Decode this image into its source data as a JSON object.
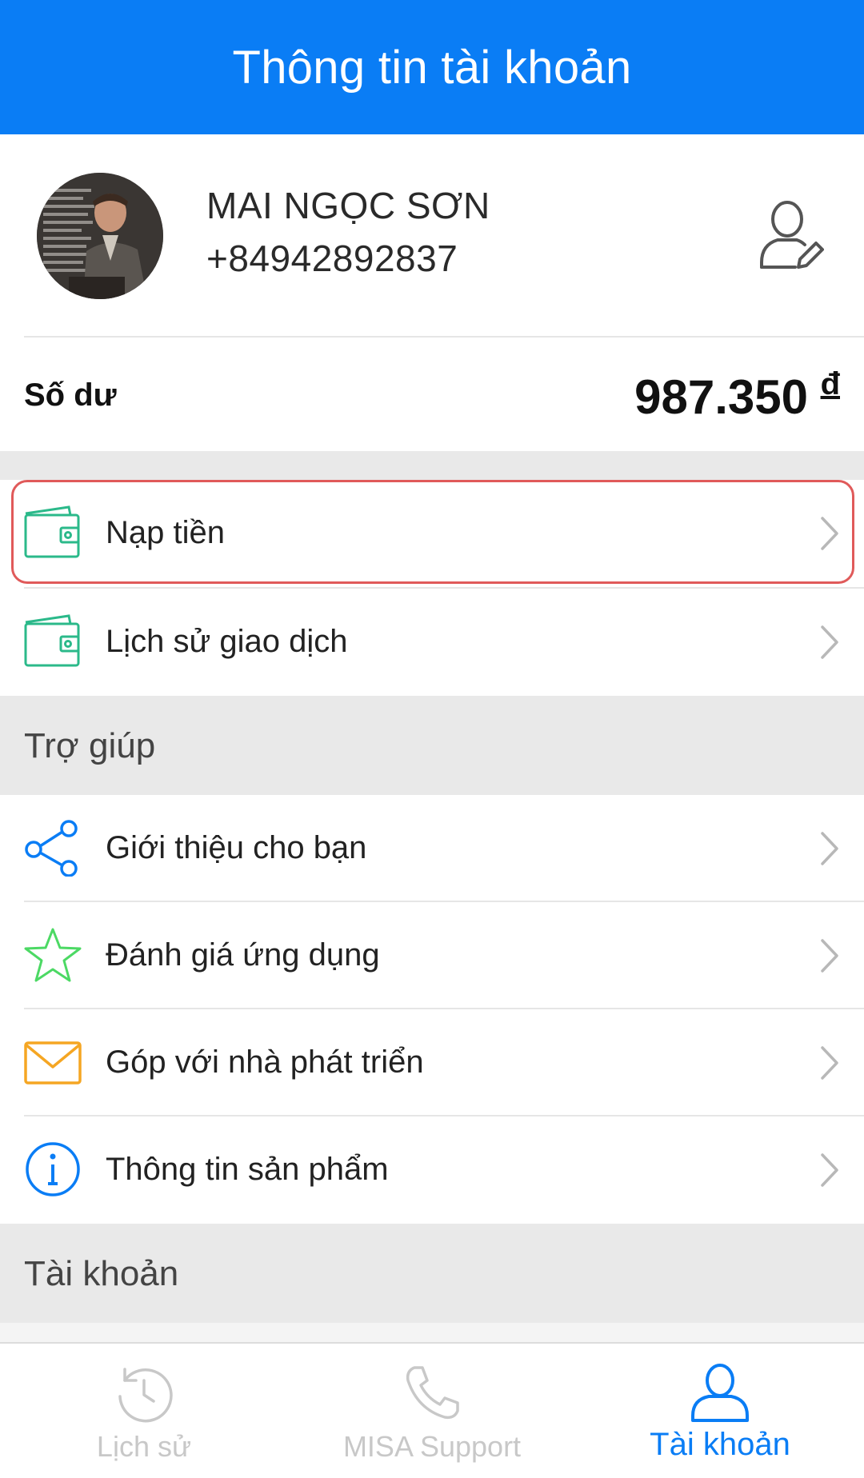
{
  "header": {
    "title": "Thông tin tài khoản"
  },
  "profile": {
    "name": "MAI NGỌC SƠN",
    "phone": "+84942892837",
    "avatar_icon": "user-avatar",
    "edit_icon": "user-edit-icon"
  },
  "balance": {
    "label": "Số dư",
    "value": "987.350",
    "currency": "đ"
  },
  "wallet_menu": [
    {
      "label": "Nạp tiền",
      "icon": "wallet-icon",
      "highlighted": true
    },
    {
      "label": "Lịch sử giao dịch",
      "icon": "wallet-icon",
      "highlighted": false
    }
  ],
  "help_section": {
    "title": "Trợ giúp",
    "items": [
      {
        "label": "Giới thiệu cho bạn",
        "icon": "share-icon"
      },
      {
        "label": "Đánh giá ứng dụng",
        "icon": "star-icon"
      },
      {
        "label": "Góp với nhà phát triển",
        "icon": "mail-icon"
      },
      {
        "label": "Thông tin sản phẩm",
        "icon": "info-icon"
      }
    ]
  },
  "account_section": {
    "title": "Tài khoản"
  },
  "tabbar": {
    "tabs": [
      {
        "label": "Lịch sử",
        "icon": "history-icon",
        "active": false
      },
      {
        "label": "MISA Support",
        "icon": "phone-icon",
        "active": false
      },
      {
        "label": "Tài khoản",
        "icon": "user-icon",
        "active": true
      }
    ]
  },
  "colors": {
    "primary": "#0a7df5",
    "wallet_green": "#2bb98a",
    "star_green": "#4cd964",
    "mail_orange": "#f5a623",
    "info_blue": "#0a7df5",
    "highlight_red": "#e05a5a",
    "section_bg": "#e9e9e9"
  }
}
